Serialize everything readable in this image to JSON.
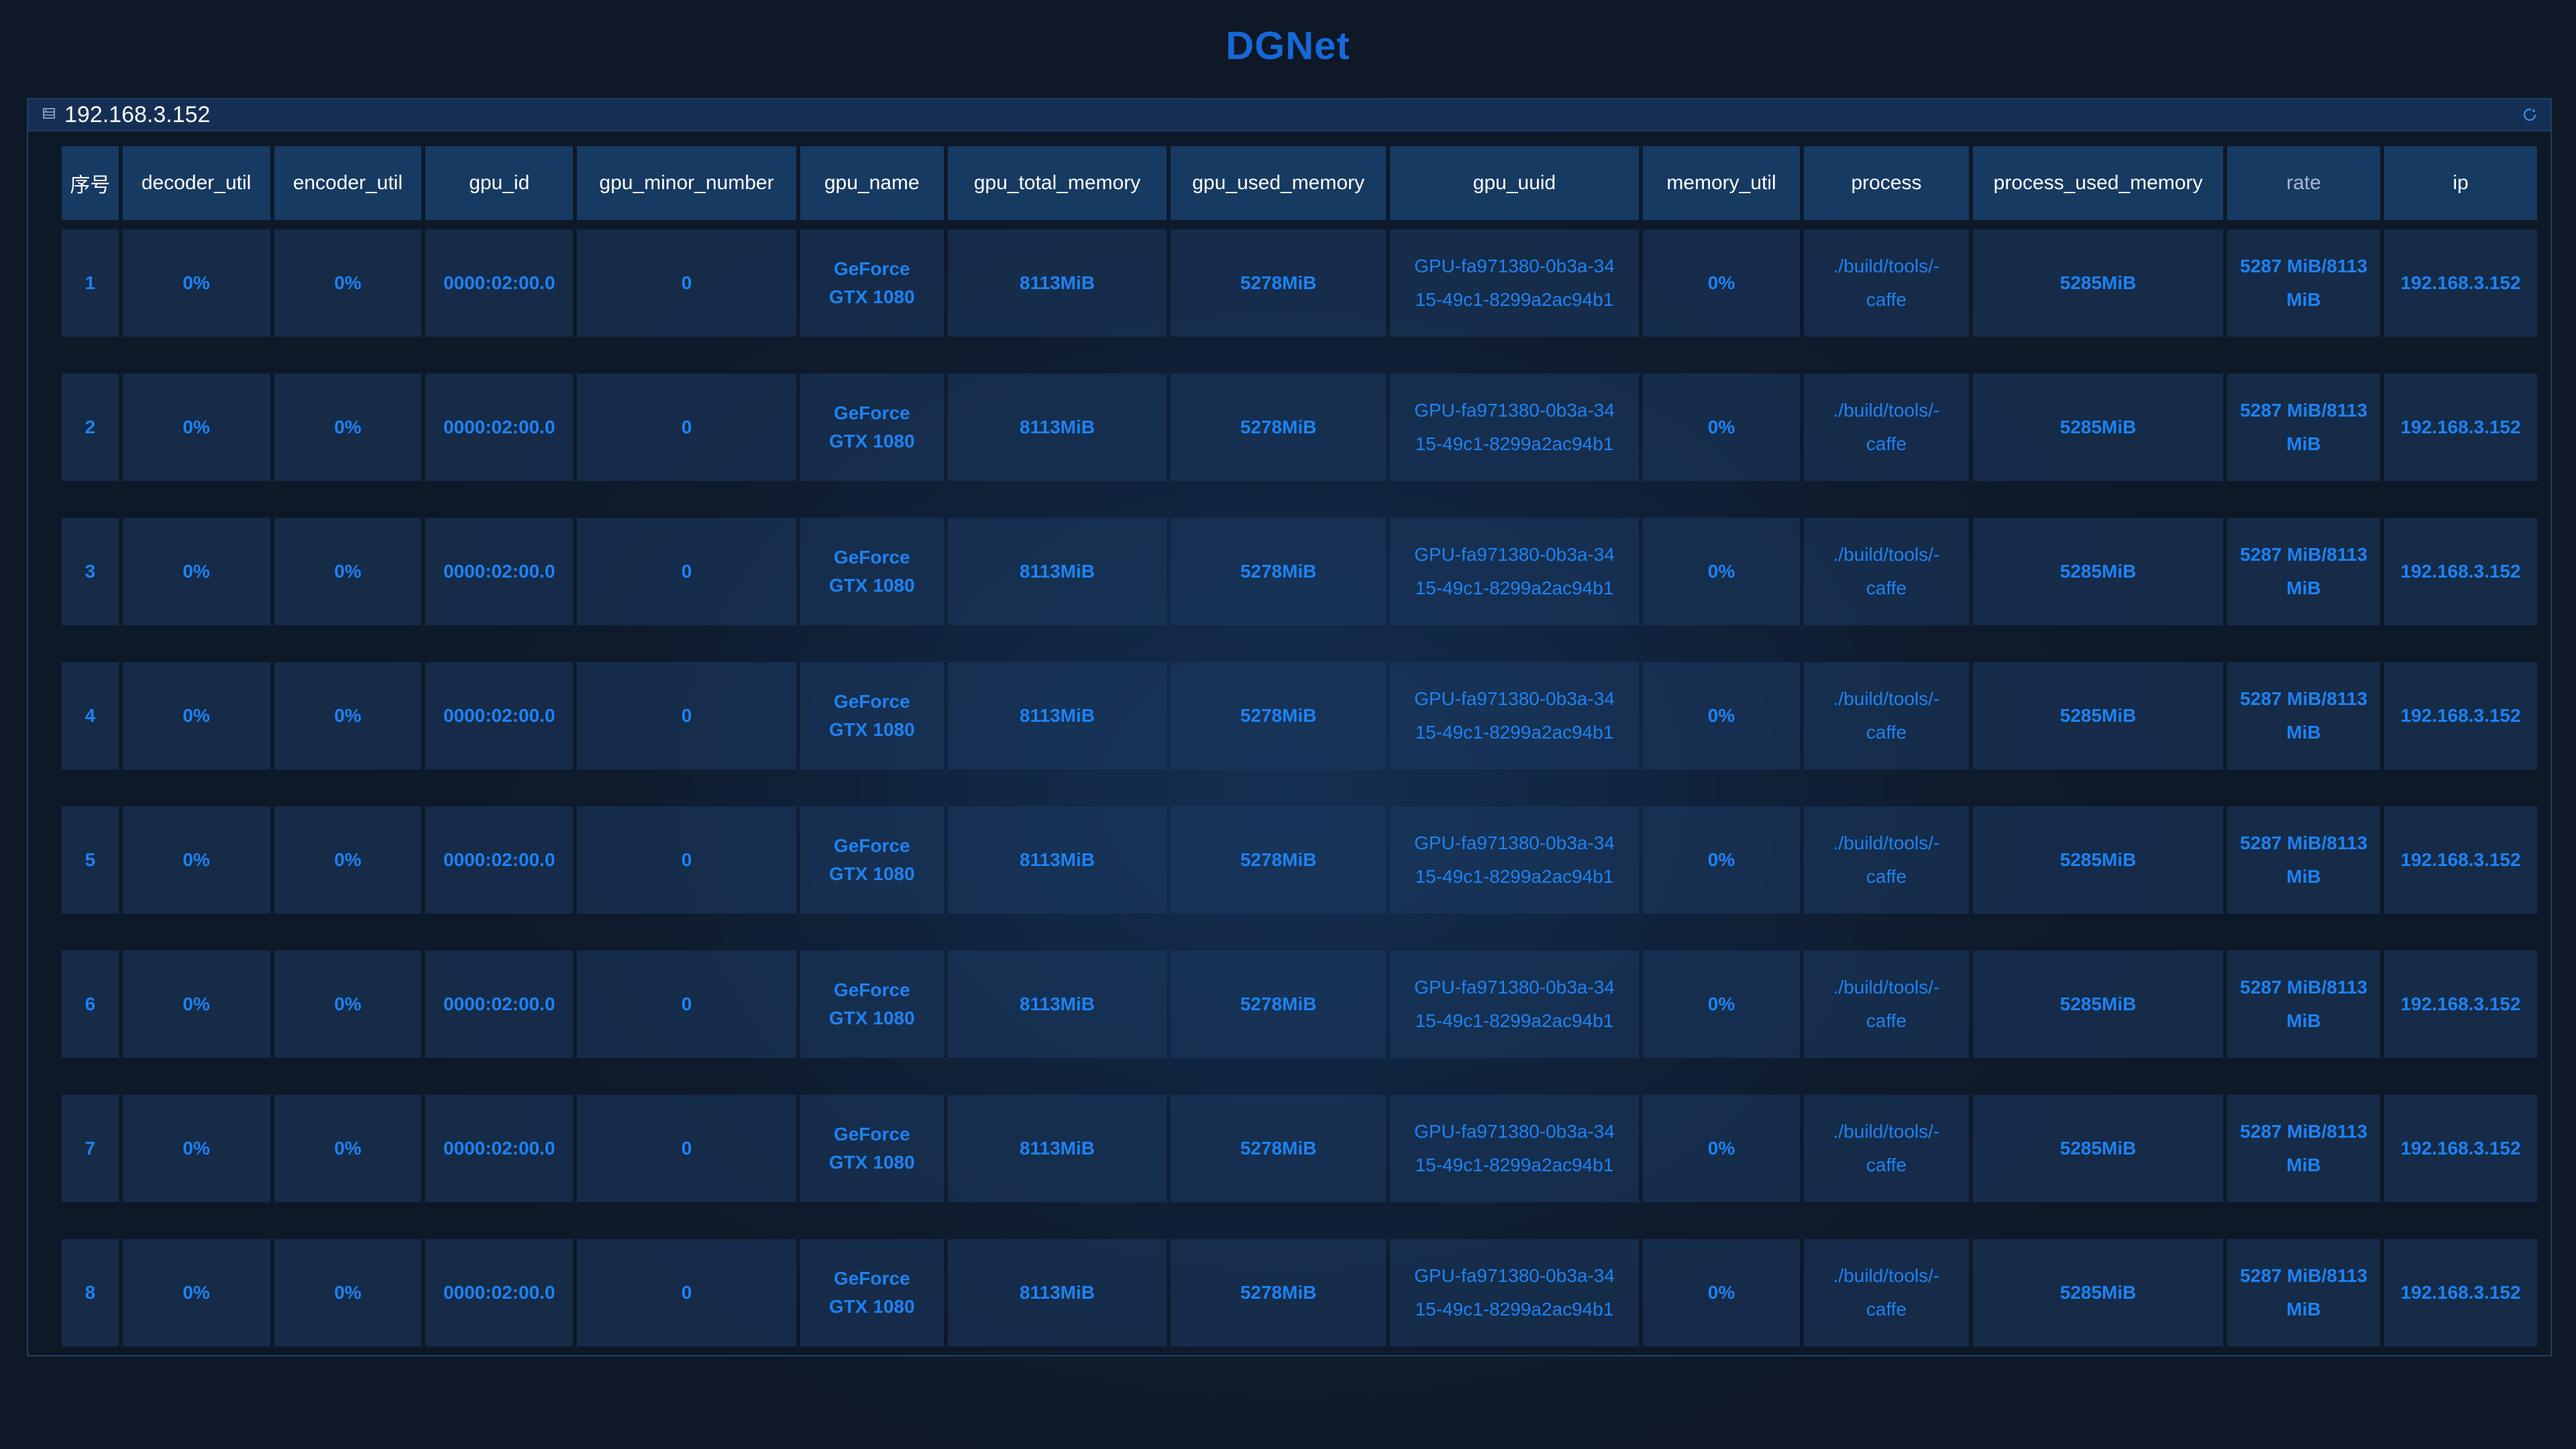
{
  "app_title": "DGNet",
  "panel": {
    "host": "192.168.3.152",
    "host_icon": "server-icon",
    "refresh_icon": "refresh-icon"
  },
  "colors": {
    "accent": "#1a7ff0",
    "title": "#1668d8",
    "header_bg": "#173a62",
    "row_bg": "#1b3a63",
    "page_bg": "#0f1b2c"
  },
  "table": {
    "columns": [
      "序号",
      "decoder_util",
      "encoder_util",
      "gpu_id",
      "gpu_minor_number",
      "gpu_name",
      "gpu_total_memory",
      "gpu_used_memory",
      "gpu_uuid",
      "memory_util",
      "process",
      "process_used_memory",
      "rate",
      "ip"
    ],
    "rows": [
      {
        "index": "1",
        "decoder_util": "0%",
        "encoder_util": "0%",
        "gpu_id": "0000:02:00.0",
        "gpu_minor_number": "0",
        "gpu_name": [
          "GeForce",
          "GTX 1080"
        ],
        "gpu_total_memory": "8113MiB",
        "gpu_used_memory": "5278MiB",
        "gpu_uuid": [
          "GPU-fa971380-0b3a-34",
          "15-49c1-8299a2ac94b1"
        ],
        "memory_util": "0%",
        "process": [
          "./build/tools/-",
          "caffe"
        ],
        "process_used_memory": "5285MiB",
        "rate": [
          "5287 MiB/8113",
          "MiB"
        ],
        "ip": "192.168.3.152"
      },
      {
        "index": "2",
        "decoder_util": "0%",
        "encoder_util": "0%",
        "gpu_id": "0000:02:00.0",
        "gpu_minor_number": "0",
        "gpu_name": [
          "GeForce",
          "GTX 1080"
        ],
        "gpu_total_memory": "8113MiB",
        "gpu_used_memory": "5278MiB",
        "gpu_uuid": [
          "GPU-fa971380-0b3a-34",
          "15-49c1-8299a2ac94b1"
        ],
        "memory_util": "0%",
        "process": [
          "./build/tools/-",
          "caffe"
        ],
        "process_used_memory": "5285MiB",
        "rate": [
          "5287 MiB/8113",
          "MiB"
        ],
        "ip": "192.168.3.152"
      },
      {
        "index": "3",
        "decoder_util": "0%",
        "encoder_util": "0%",
        "gpu_id": "0000:02:00.0",
        "gpu_minor_number": "0",
        "gpu_name": [
          "GeForce",
          "GTX 1080"
        ],
        "gpu_total_memory": "8113MiB",
        "gpu_used_memory": "5278MiB",
        "gpu_uuid": [
          "GPU-fa971380-0b3a-34",
          "15-49c1-8299a2ac94b1"
        ],
        "memory_util": "0%",
        "process": [
          "./build/tools/-",
          "caffe"
        ],
        "process_used_memory": "5285MiB",
        "rate": [
          "5287 MiB/8113",
          "MiB"
        ],
        "ip": "192.168.3.152"
      },
      {
        "index": "4",
        "decoder_util": "0%",
        "encoder_util": "0%",
        "gpu_id": "0000:02:00.0",
        "gpu_minor_number": "0",
        "gpu_name": [
          "GeForce",
          "GTX 1080"
        ],
        "gpu_total_memory": "8113MiB",
        "gpu_used_memory": "5278MiB",
        "gpu_uuid": [
          "GPU-fa971380-0b3a-34",
          "15-49c1-8299a2ac94b1"
        ],
        "memory_util": "0%",
        "process": [
          "./build/tools/-",
          "caffe"
        ],
        "process_used_memory": "5285MiB",
        "rate": [
          "5287 MiB/8113",
          "MiB"
        ],
        "ip": "192.168.3.152"
      },
      {
        "index": "5",
        "decoder_util": "0%",
        "encoder_util": "0%",
        "gpu_id": "0000:02:00.0",
        "gpu_minor_number": "0",
        "gpu_name": [
          "GeForce",
          "GTX 1080"
        ],
        "gpu_total_memory": "8113MiB",
        "gpu_used_memory": "5278MiB",
        "gpu_uuid": [
          "GPU-fa971380-0b3a-34",
          "15-49c1-8299a2ac94b1"
        ],
        "memory_util": "0%",
        "process": [
          "./build/tools/-",
          "caffe"
        ],
        "process_used_memory": "5285MiB",
        "rate": [
          "5287 MiB/8113",
          "MiB"
        ],
        "ip": "192.168.3.152"
      },
      {
        "index": "6",
        "decoder_util": "0%",
        "encoder_util": "0%",
        "gpu_id": "0000:02:00.0",
        "gpu_minor_number": "0",
        "gpu_name": [
          "GeForce",
          "GTX 1080"
        ],
        "gpu_total_memory": "8113MiB",
        "gpu_used_memory": "5278MiB",
        "gpu_uuid": [
          "GPU-fa971380-0b3a-34",
          "15-49c1-8299a2ac94b1"
        ],
        "memory_util": "0%",
        "process": [
          "./build/tools/-",
          "caffe"
        ],
        "process_used_memory": "5285MiB",
        "rate": [
          "5287 MiB/8113",
          "MiB"
        ],
        "ip": "192.168.3.152"
      },
      {
        "index": "7",
        "decoder_util": "0%",
        "encoder_util": "0%",
        "gpu_id": "0000:02:00.0",
        "gpu_minor_number": "0",
        "gpu_name": [
          "GeForce",
          "GTX 1080"
        ],
        "gpu_total_memory": "8113MiB",
        "gpu_used_memory": "5278MiB",
        "gpu_uuid": [
          "GPU-fa971380-0b3a-34",
          "15-49c1-8299a2ac94b1"
        ],
        "memory_util": "0%",
        "process": [
          "./build/tools/-",
          "caffe"
        ],
        "process_used_memory": "5285MiB",
        "rate": [
          "5287 MiB/8113",
          "MiB"
        ],
        "ip": "192.168.3.152"
      },
      {
        "index": "8",
        "decoder_util": "0%",
        "encoder_util": "0%",
        "gpu_id": "0000:02:00.0",
        "gpu_minor_number": "0",
        "gpu_name": [
          "GeForce",
          "GTX 1080"
        ],
        "gpu_total_memory": "8113MiB",
        "gpu_used_memory": "5278MiB",
        "gpu_uuid": [
          "GPU-fa971380-0b3a-34",
          "15-49c1-8299a2ac94b1"
        ],
        "memory_util": "0%",
        "process": [
          "./build/tools/-",
          "caffe"
        ],
        "process_used_memory": "5285MiB",
        "rate": [
          "5287 MiB/8113",
          "MiB"
        ],
        "ip": "192.168.3.152"
      }
    ]
  }
}
